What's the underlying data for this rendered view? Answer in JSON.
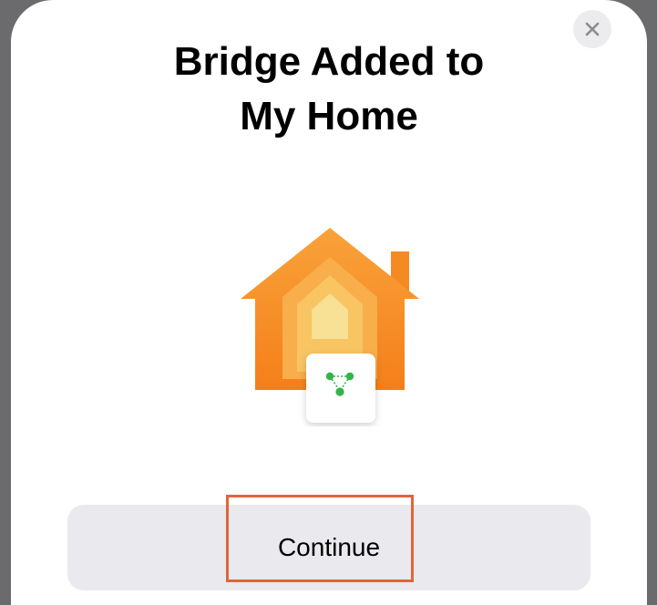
{
  "dialog": {
    "title_line1": "Bridge Added to",
    "title_line2": "My Home",
    "close_icon": "close-icon",
    "illustration_icon": "home-bridge-icon",
    "continue_label": "Continue"
  },
  "colors": {
    "backdrop": "#6b6b6e",
    "sheet": "#ffffff",
    "house_outer": "#f68b1e",
    "house_inner": "#f7d67a",
    "bridge_dots": "#33b34a",
    "button_bg": "#e9e9ee",
    "highlight": "#e3643a"
  }
}
